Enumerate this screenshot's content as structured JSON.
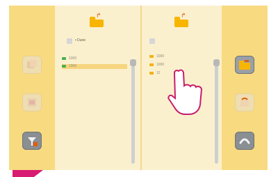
{
  "left_pane": {
    "header_label": "• Dune",
    "items": [
      {
        "label": "1000"
      },
      {
        "label": "1000"
      }
    ]
  },
  "right_pane": {
    "items": [
      {
        "label": "1000"
      },
      {
        "label": "1000"
      },
      {
        "label": "12"
      }
    ]
  },
  "left_buttons": [
    "copy-icon",
    "delete-icon",
    "filter-icon"
  ],
  "right_buttons": [
    "open-folder-icon",
    "restore-icon",
    "back-icon"
  ],
  "colors": {
    "screen_bg": "#f9e29a",
    "folder": "#f7b500",
    "accent": "#d81b73"
  }
}
